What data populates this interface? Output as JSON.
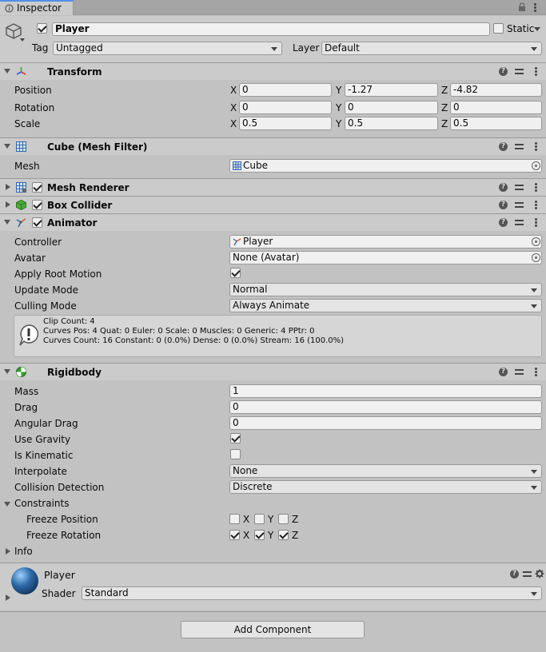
{
  "tab": {
    "title": "Inspector"
  },
  "gameobject": {
    "active": true,
    "name": "Player",
    "static_label": "Static",
    "static_checked": false,
    "tag_label": "Tag",
    "tag_value": "Untagged",
    "layer_label": "Layer",
    "layer_value": "Default"
  },
  "transform": {
    "title": "Transform",
    "position_label": "Position",
    "rotation_label": "Rotation",
    "scale_label": "Scale",
    "axis_x": "X",
    "axis_y": "Y",
    "axis_z": "Z",
    "position": {
      "x": "0",
      "y": "-1.27",
      "z": "-4.82"
    },
    "rotation": {
      "x": "0",
      "y": "0",
      "z": "0"
    },
    "scale": {
      "x": "0.5",
      "y": "0.5",
      "z": "0.5"
    }
  },
  "mesh_filter": {
    "title": "Cube (Mesh Filter)",
    "mesh_label": "Mesh",
    "mesh_value": "Cube"
  },
  "mesh_renderer": {
    "title": "Mesh Renderer",
    "enabled": true
  },
  "box_collider": {
    "title": "Box Collider",
    "enabled": true
  },
  "animator": {
    "title": "Animator",
    "enabled": true,
    "controller_label": "Controller",
    "controller_value": "Player",
    "avatar_label": "Avatar",
    "avatar_value": "None (Avatar)",
    "root_motion_label": "Apply Root Motion",
    "root_motion": true,
    "update_mode_label": "Update Mode",
    "update_mode": "Normal",
    "culling_mode_label": "Culling Mode",
    "culling_mode": "Always Animate",
    "info_line1": "Clip Count: 4",
    "info_line2": "Curves Pos: 4 Quat: 0 Euler: 0 Scale: 0 Muscles: 0 Generic: 4 PPtr: 0",
    "info_line3": "Curves Count: 16 Constant: 0 (0.0%) Dense: 0 (0.0%) Stream: 16 (100.0%)"
  },
  "rigidbody": {
    "title": "Rigidbody",
    "mass_label": "Mass",
    "mass": "1",
    "drag_label": "Drag",
    "drag": "0",
    "angular_drag_label": "Angular Drag",
    "angular_drag": "0",
    "use_gravity_label": "Use Gravity",
    "use_gravity": true,
    "is_kinematic_label": "Is Kinematic",
    "is_kinematic": false,
    "interpolate_label": "Interpolate",
    "interpolate": "None",
    "collision_label": "Collision Detection",
    "collision": "Discrete",
    "constraints_label": "Constraints",
    "freeze_position_label": "Freeze Position",
    "freeze_rotation_label": "Freeze Rotation",
    "axis_x": "X",
    "axis_y": "Y",
    "axis_z": "Z",
    "freeze_position": {
      "x": false,
      "y": false,
      "z": false
    },
    "freeze_rotation": {
      "x": true,
      "y": true,
      "z": true
    },
    "info_label": "Info"
  },
  "material": {
    "name": "Player",
    "shader_label": "Shader",
    "shader_value": "Standard"
  },
  "add_component_label": "Add Component",
  "colors": {
    "background": "#c2c2c2",
    "header": "#cbcbcb",
    "tab_accent": "#4f8fe8",
    "material_sphere": "#2e6aa8"
  }
}
